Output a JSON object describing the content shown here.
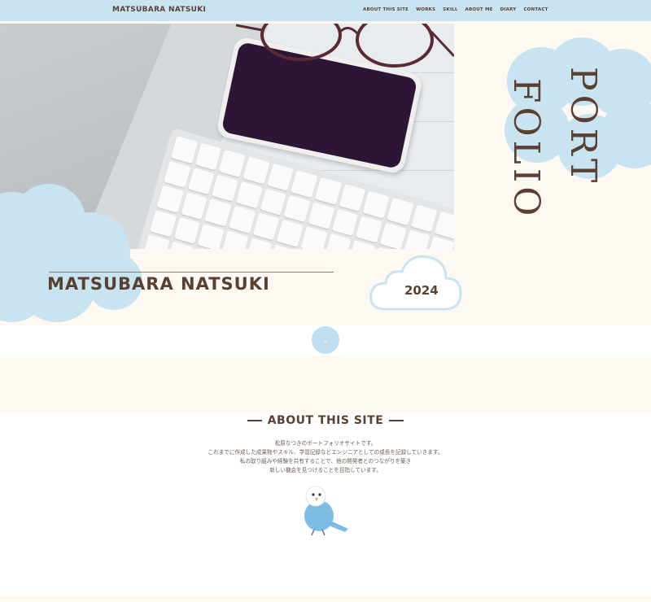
{
  "header": {
    "site_name": "MATSUBARA NATSUKI",
    "nav": [
      "ABOUT THIS SITE",
      "WORKS",
      "SKILL",
      "ABOUT ME",
      "DIARY",
      "CONTACT"
    ]
  },
  "hero": {
    "title_col1": "PORT",
    "title_col2": "FOLIO",
    "name": "MATSUBARA NATSUKI",
    "year": "2024"
  },
  "about": {
    "heading": "ABOUT THIS SITE",
    "lines": [
      "松原なつきのポートフォリオサイトです。",
      "これまでに作成した成果物やスキル、学習記録などエンジニアとしての成長を記録していきます。",
      "私の取り組みや経験を共有することで、他の開発者とのつながりを築き",
      "新しい機会を見つけることを目指しています。"
    ]
  },
  "colors": {
    "accent": "#c8e4f1",
    "text": "#5a4033",
    "background": "#fdf9f2"
  },
  "icons": {
    "scroll": "chevron-down-icon",
    "mascot": "budgie-icon"
  }
}
